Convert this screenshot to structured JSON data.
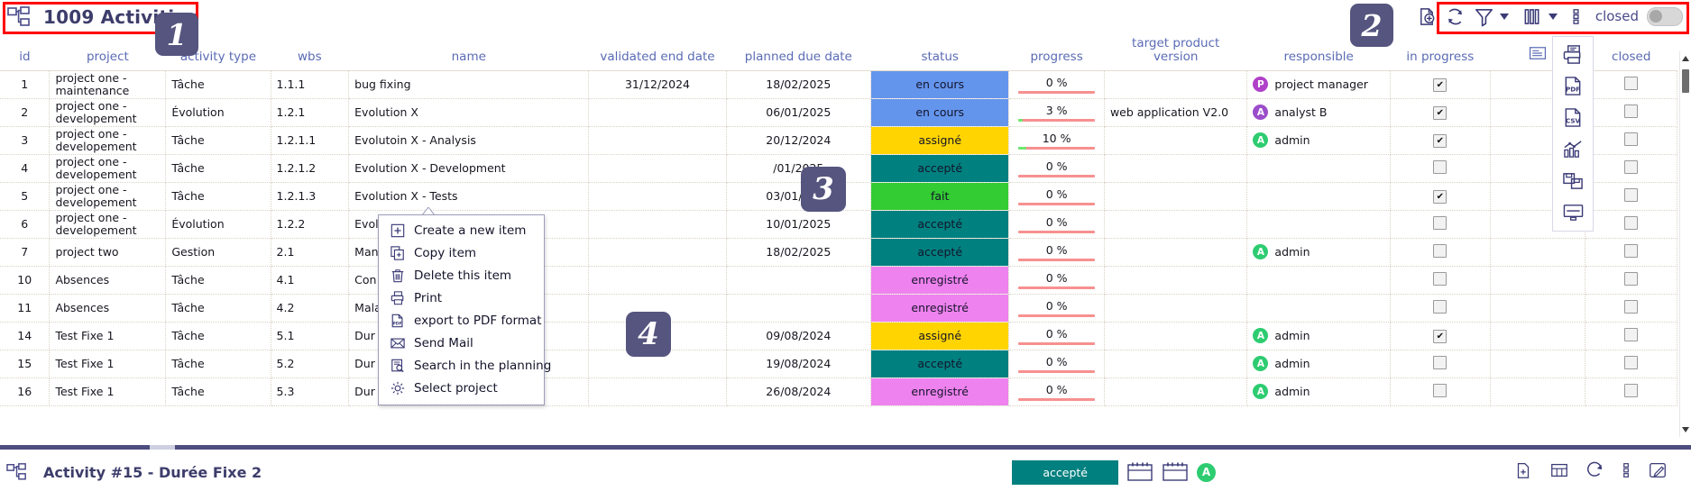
{
  "header": {
    "title": "1009 Activities",
    "title_icon": "org-chart-icon"
  },
  "toolbar": {
    "icons": [
      {
        "name": "add-document-icon",
        "label": "add"
      },
      {
        "name": "refresh-icon",
        "label": "refresh"
      },
      {
        "name": "filter-icon",
        "label": "filter"
      },
      {
        "name": "columns-icon",
        "label": "columns"
      },
      {
        "name": "more-options-icon",
        "label": "more"
      }
    ],
    "closed_label": "closed",
    "toggle_state": "off"
  },
  "side_toolbar": {
    "icons": [
      {
        "name": "print-icon",
        "label": "Print"
      },
      {
        "name": "export-pdf-icon",
        "label": "PDF"
      },
      {
        "name": "export-csv-icon",
        "label": "CSV"
      },
      {
        "name": "chart-icon",
        "label": "Chart"
      },
      {
        "name": "save-icon",
        "label": "Save"
      },
      {
        "name": "display-icon",
        "label": "Display"
      }
    ]
  },
  "table": {
    "columns": [
      "id",
      "project",
      "activity type",
      "wbs",
      "name",
      "validated end date",
      "planned due date",
      "status",
      "progress",
      "target product version",
      "responsible",
      "in progress",
      "",
      "closed"
    ],
    "rows": [
      {
        "id": "1",
        "project": "project one - maintenance",
        "activity_type": "Tâche",
        "wbs": "1.1.1",
        "name": "bug fixing",
        "validated_end_date": "31/12/2024",
        "planned_due_date": "18/02/2025",
        "status": "en cours",
        "status_color": "#6495ed",
        "progress": "0 %",
        "progress_value": 0,
        "target_version": "",
        "responsible": "project manager",
        "responsible_initial": "P",
        "responsible_color": "#b041c8",
        "in_progress": true,
        "closed": false
      },
      {
        "id": "2",
        "project": "project one - developement",
        "activity_type": "Évolution",
        "wbs": "1.2.1",
        "name": "Evolution X",
        "validated_end_date": "",
        "planned_due_date": "06/01/2025",
        "status": "en cours",
        "status_color": "#6495ed",
        "progress": "3 %",
        "progress_value": 3,
        "target_version": "web application V2.0",
        "responsible": "analyst B",
        "responsible_initial": "A",
        "responsible_color": "#9b4dca",
        "in_progress": true,
        "closed": false
      },
      {
        "id": "3",
        "project": "project one - developement",
        "activity_type": "Tâche",
        "wbs": "1.2.1.1",
        "name": "Evolutoin X - Analysis",
        "validated_end_date": "",
        "planned_due_date": "20/12/2024",
        "status": "assigné",
        "status_color": "#ffd400",
        "progress": "10 %",
        "progress_value": 10,
        "target_version": "",
        "responsible": "admin",
        "responsible_initial": "A",
        "responsible_color": "#2ecc71",
        "in_progress": true,
        "closed": false
      },
      {
        "id": "4",
        "project": "project one - developement",
        "activity_type": "Tâche",
        "wbs": "1.2.1.2",
        "name": "Evolution X - Development",
        "validated_end_date": "",
        "planned_due_date": "/01/2025",
        "status": "accepté",
        "status_color": "#00807f",
        "progress": "0 %",
        "progress_value": 0,
        "target_version": "",
        "responsible": "",
        "responsible_initial": "",
        "responsible_color": "",
        "in_progress": false,
        "closed": false
      },
      {
        "id": "5",
        "project": "project one - developement",
        "activity_type": "Tâche",
        "wbs": "1.2.1.3",
        "name": "Evolution X - Tests",
        "validated_end_date": "",
        "planned_due_date": "03/01/2025",
        "status": "fait",
        "status_color": "#33cc33",
        "progress": "0 %",
        "progress_value": 0,
        "target_version": "",
        "responsible": "",
        "responsible_initial": "",
        "responsible_color": "",
        "in_progress": true,
        "closed": false
      },
      {
        "id": "6",
        "project": "project one - developement",
        "activity_type": "Évolution",
        "wbs": "1.2.2",
        "name": "Evol",
        "validated_end_date": "",
        "planned_due_date": "10/01/2025",
        "status": "accepté",
        "status_color": "#00807f",
        "progress": "0 %",
        "progress_value": 0,
        "target_version": "",
        "responsible": "",
        "responsible_initial": "",
        "responsible_color": "",
        "in_progress": false,
        "closed": false
      },
      {
        "id": "7",
        "project": "project two",
        "activity_type": "Gestion",
        "wbs": "2.1",
        "name": "Man",
        "validated_end_date": "",
        "planned_due_date": "18/02/2025",
        "status": "accepté",
        "status_color": "#00807f",
        "progress": "0 %",
        "progress_value": 0,
        "target_version": "",
        "responsible": "admin",
        "responsible_initial": "A",
        "responsible_color": "#2ecc71",
        "in_progress": false,
        "closed": false
      },
      {
        "id": "10",
        "project": "Absences",
        "activity_type": "Tâche",
        "wbs": "4.1",
        "name": "Con",
        "validated_end_date": "",
        "planned_due_date": "",
        "status": "enregistré",
        "status_color": "#ee82ee",
        "progress": "0 %",
        "progress_value": 0,
        "target_version": "",
        "responsible": "",
        "responsible_initial": "",
        "responsible_color": "",
        "in_progress": false,
        "closed": false
      },
      {
        "id": "11",
        "project": "Absences",
        "activity_type": "Tâche",
        "wbs": "4.2",
        "name": "Mala",
        "validated_end_date": "",
        "planned_due_date": "",
        "status": "enregistré",
        "status_color": "#ee82ee",
        "progress": "0 %",
        "progress_value": 0,
        "target_version": "",
        "responsible": "",
        "responsible_initial": "",
        "responsible_color": "",
        "in_progress": false,
        "closed": false
      },
      {
        "id": "14",
        "project": "Test Fixe 1",
        "activity_type": "Tâche",
        "wbs": "5.1",
        "name": "Dur",
        "validated_end_date": "",
        "planned_due_date": "09/08/2024",
        "status": "assigné",
        "status_color": "#ffd400",
        "progress": "0 %",
        "progress_value": 0,
        "target_version": "",
        "responsible": "admin",
        "responsible_initial": "A",
        "responsible_color": "#2ecc71",
        "in_progress": true,
        "closed": false
      },
      {
        "id": "15",
        "project": "Test Fixe 1",
        "activity_type": "Tâche",
        "wbs": "5.2",
        "name": "Dur",
        "validated_end_date": "",
        "planned_due_date": "19/08/2024",
        "status": "accepté",
        "status_color": "#00807f",
        "progress": "0 %",
        "progress_value": 0,
        "target_version": "",
        "responsible": "admin",
        "responsible_initial": "A",
        "responsible_color": "#2ecc71",
        "in_progress": false,
        "closed": false
      },
      {
        "id": "16",
        "project": "Test Fixe 1",
        "activity_type": "Tâche",
        "wbs": "5.3",
        "name": "Dur",
        "validated_end_date": "",
        "planned_due_date": "26/08/2024",
        "status": "enregistré",
        "status_color": "#ee82ee",
        "progress": "0 %",
        "progress_value": 0,
        "target_version": "",
        "responsible": "admin",
        "responsible_initial": "A",
        "responsible_color": "#2ecc71",
        "in_progress": false,
        "closed": false
      }
    ]
  },
  "context_menu": {
    "items": [
      {
        "icon": "plus-box-icon",
        "label": "Create a new item"
      },
      {
        "icon": "copy-icon",
        "label": "Copy item"
      },
      {
        "icon": "trash-icon",
        "label": "Delete this item"
      },
      {
        "icon": "print-icon",
        "label": "Print"
      },
      {
        "icon": "export-pdf-icon",
        "label": "export to PDF format"
      },
      {
        "icon": "mail-icon",
        "label": "Send Mail"
      },
      {
        "icon": "search-planning-icon",
        "label": "Search in the planning"
      },
      {
        "icon": "gear-icon",
        "label": "Select project"
      }
    ]
  },
  "bottom_bar": {
    "icon": "org-chart-icon",
    "title": "Activity #15 - Durée Fixe 2",
    "status": "accepté",
    "avatar_initial": "A",
    "avatar_color": "#2ecc71"
  },
  "annotations": [
    {
      "num": "1"
    },
    {
      "num": "2"
    },
    {
      "num": "3"
    },
    {
      "num": "4"
    }
  ],
  "colors": {
    "accent": "#4a4a8a",
    "header_text": "#5a6bb5",
    "highlight": "#ff0000",
    "badge_bg": "#55557f"
  }
}
